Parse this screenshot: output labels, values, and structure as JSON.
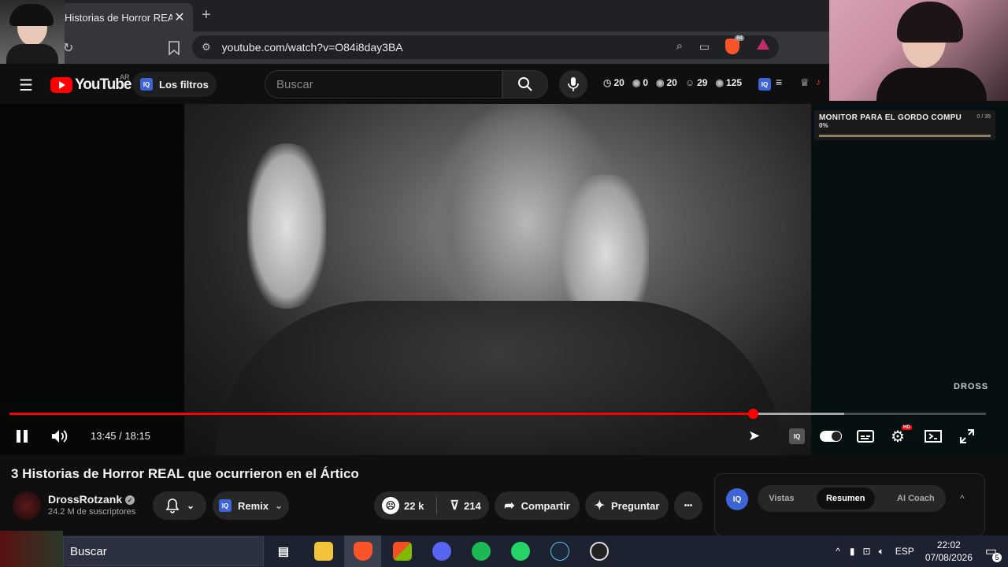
{
  "browser": {
    "tab_title": "Historias de Horror REAL",
    "tab_close": "✕",
    "new_tab": "+",
    "url": "youtube.com/watch?v=O84i8day3BA",
    "brave_badge": "84"
  },
  "youtube": {
    "logo_text": "YouTube",
    "region": "AR",
    "filters_label": "Los filtros",
    "search_placeholder": "Buscar",
    "iq_label": "IQ",
    "stats": [
      {
        "icon": "clock-icon",
        "glyph": "◷",
        "value": "20"
      },
      {
        "icon": "eye-icon",
        "glyph": "◉",
        "value": "0"
      },
      {
        "icon": "eye-icon",
        "glyph": "◉",
        "value": "20"
      },
      {
        "icon": "person-icon",
        "glyph": "☺",
        "value": "29"
      },
      {
        "icon": "eye-icon",
        "glyph": "◉",
        "value": "125"
      }
    ]
  },
  "overlay": {
    "goal_title": "MONITOR PARA EL GORDO COMPU",
    "goal_count": "0 / 35",
    "goal_percent": "0%",
    "watermark": "DROSS"
  },
  "player": {
    "time": "13:45 / 18:15",
    "progress": 0.7613,
    "buffered": 0.855,
    "hd_badge": "HD"
  },
  "video": {
    "title": "3 Historias de Horror REAL que ocurrieron en el Ártico",
    "channel": "DrossRotzank",
    "verified": "✓",
    "subscribers": "24.2 M de suscriptores",
    "remix_label": "Remix",
    "likes": "22 k",
    "dislikes": "214",
    "share_label": "Compartir",
    "ask_label": "Preguntar",
    "more_label": "•••"
  },
  "summary_panel": {
    "tabs": [
      "Vistas",
      "Resumen",
      "AI Coach"
    ],
    "active_tab": "Resumen",
    "collapse": "^"
  },
  "taskbar": {
    "search_label": "Buscar",
    "language": "ESP",
    "time": "22:02",
    "date": "07/08/2026",
    "notifications": "5"
  },
  "colors": {
    "accent": "#ff0000",
    "iq_blue": "#3e65d8",
    "background": "#0f0f0f"
  }
}
